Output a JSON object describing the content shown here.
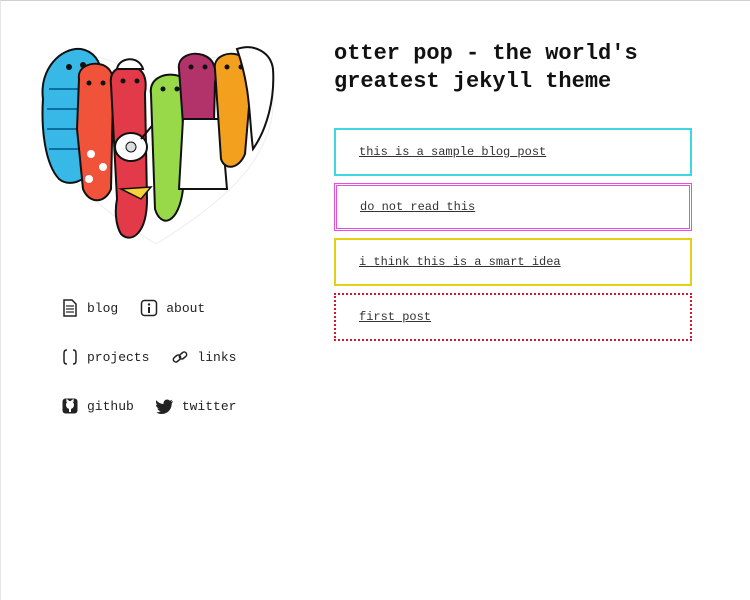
{
  "site": {
    "title": "otter pop - the world's greatest jekyll theme"
  },
  "nav": {
    "rows": [
      [
        {
          "label": "blog",
          "icon": "document-icon"
        },
        {
          "label": "about",
          "icon": "info-icon"
        }
      ],
      [
        {
          "label": "projects",
          "icon": "brackets-icon"
        },
        {
          "label": "links",
          "icon": "chain-link-icon"
        }
      ],
      [
        {
          "label": "github",
          "icon": "github-icon"
        },
        {
          "label": "twitter",
          "icon": "twitter-bird-icon"
        }
      ]
    ]
  },
  "posts": [
    {
      "title": "this is a sample blog post",
      "border_color": "#3fd8de"
    },
    {
      "title": "do not read this",
      "border_color": "#e64ee0"
    },
    {
      "title": "i think this is a smart idea",
      "border_color": "#e3cf1a"
    },
    {
      "title": "first post",
      "border_color": "#cc1b2c"
    }
  ],
  "hero": {
    "icon": "otter-pop-heart-illustration",
    "colors": [
      "#37b8e6",
      "#f0533a",
      "#e23a48",
      "#98d94a",
      "#b2326a",
      "#f2a01d"
    ]
  }
}
